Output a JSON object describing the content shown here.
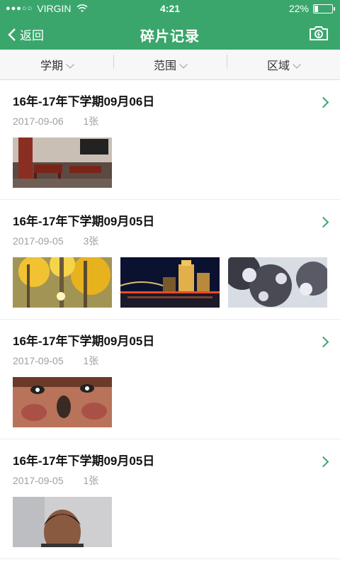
{
  "status_bar": {
    "signal": "●●●○○",
    "carrier": "VIRGIN",
    "time": "4:21",
    "battery": "22%",
    "battery_level": 0.22
  },
  "nav": {
    "back_label": "返回",
    "title": "碎片记录",
    "camera_icon": "camera-icon"
  },
  "filters": [
    {
      "label": "学期"
    },
    {
      "label": "范围"
    },
    {
      "label": "区域"
    }
  ],
  "records": [
    {
      "title": "16年-17年下学期09月06日",
      "date": "2017-09-06",
      "count": "1张"
    },
    {
      "title": "16年-17年下学期09月05日",
      "date": "2017-09-05",
      "count": "3张"
    },
    {
      "title": "16年-17年下学期09月05日",
      "date": "2017-09-05",
      "count": "1张"
    },
    {
      "title": "16年-17年下学期09月05日",
      "date": "2017-09-05",
      "count": "1张"
    }
  ],
  "colors": {
    "brand_green": "#3aa66c",
    "meta_gray": "#a0a0a0"
  }
}
